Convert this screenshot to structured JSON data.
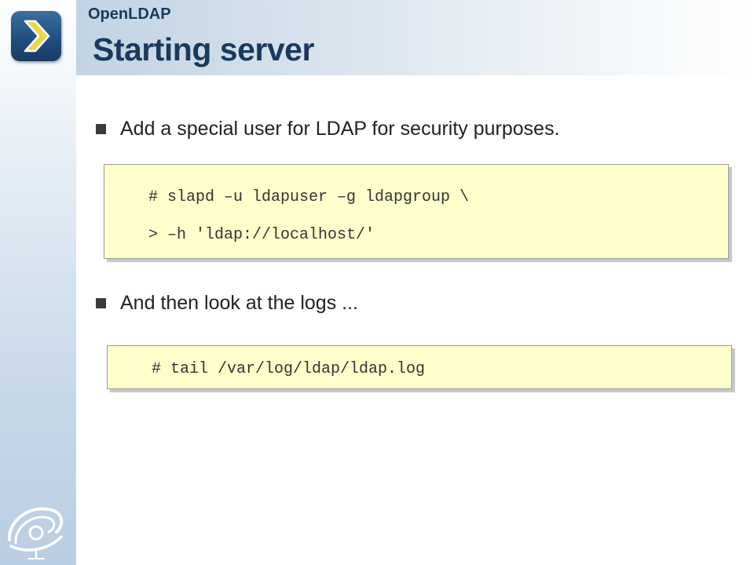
{
  "header": {
    "app_name": "OpenLDAP",
    "title": "Starting server"
  },
  "bullets": [
    {
      "text": "Add a special user for LDAP for security purposes."
    },
    {
      "text": "And then look at the logs ..."
    }
  ],
  "code_blocks": [
    {
      "lines": [
        "# slapd –u ldapuser –g ldapgroup \\",
        "> –h 'ldap://localhost/'"
      ]
    },
    {
      "lines": [
        "# tail /var/log/ldap/ldap.log"
      ]
    }
  ],
  "icons": {
    "logo": "chevron-right-icon",
    "bottom": "swirl-logo-icon"
  },
  "colors": {
    "title": "#1a3a5c",
    "code_background": "#ffffcc",
    "logo_tile": "#1f4f7f",
    "chevron": "#e8d84a"
  }
}
